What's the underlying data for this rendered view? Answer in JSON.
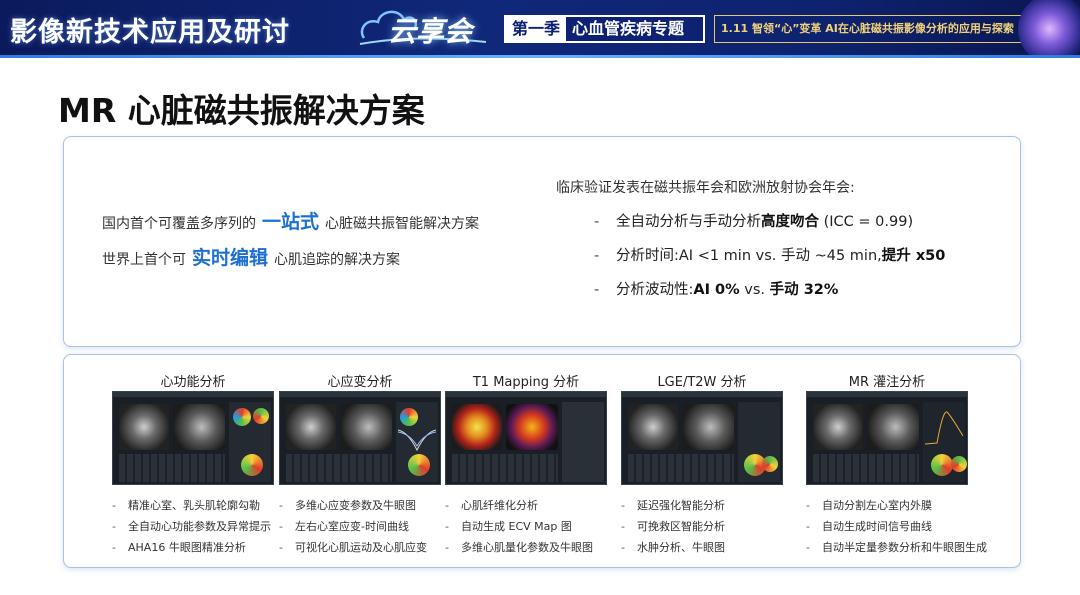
{
  "banner": {
    "title": "影像新技术应用及研讨",
    "logo_text": "云享会",
    "season": "第一季",
    "topic": "心血管疾病专题",
    "event": "1.11 智领“心”变革 AI在心脏磁共振影像分析的应用与探索",
    "colors": {
      "banner_bg": "#10287a",
      "accent": "#1d6fd0",
      "border": "#a9c2e6"
    }
  },
  "page_title": "MR 心脏磁共振解决方案",
  "features": [
    {
      "before": "国内首个可覆盖多序列的",
      "highlight": "一站式",
      "after": "心脏磁共振智能解决方案"
    },
    {
      "before": "世界上首个可",
      "highlight": "实时编辑",
      "after": "心肌追踪的解决方案"
    }
  ],
  "clinical": {
    "heading": "临床验证发表在磁共振年会和欧洲放射协会年会:",
    "items": [
      {
        "dash": "-",
        "text": "全自动分析与手动分析",
        "bold": "高度吻合",
        "tail": " (ICC = 0.99)"
      },
      {
        "dash": "-",
        "text": "分析时间:AI <1 min vs. 手动 ~45 min,",
        "bold": "提升 x50",
        "tail": ""
      },
      {
        "dash": "-",
        "text": "分析波动性:",
        "bold": "AI 0%",
        "mid": " vs. ",
        "bold2": "手动 32%"
      }
    ]
  },
  "modules": [
    {
      "title": "心功能分析",
      "icon": "heart-function-screenshot",
      "bullets": [
        "精准心室、乳头肌轮廓勾勒",
        "全自动心功能参数及异常提示",
        "AHA16 牛眼图精准分析"
      ]
    },
    {
      "title": "心应变分析",
      "icon": "strain-screenshot",
      "bullets": [
        "多维心应变参数及牛眼图",
        "左右心室应变-时间曲线",
        "可视化心肌运动及心肌应变"
      ]
    },
    {
      "title": "T1 Mapping 分析",
      "icon": "t1-mapping-screenshot",
      "bullets": [
        "心肌纤维化分析",
        "自动生成 ECV Map 图",
        "多维心肌量化参数及牛眼图"
      ]
    },
    {
      "title": "LGE/T2W 分析",
      "icon": "lge-screenshot",
      "bullets": [
        "延迟强化智能分析",
        "可挽救区智能分析",
        "水肿分析、牛眼图"
      ]
    },
    {
      "title": "MR 灌注分析",
      "icon": "perfusion-screenshot",
      "bullets": [
        "自动分割左心室内外膜",
        "自动生成时间信号曲线",
        "自动半定量参数分析和牛眼图生成"
      ]
    }
  ]
}
